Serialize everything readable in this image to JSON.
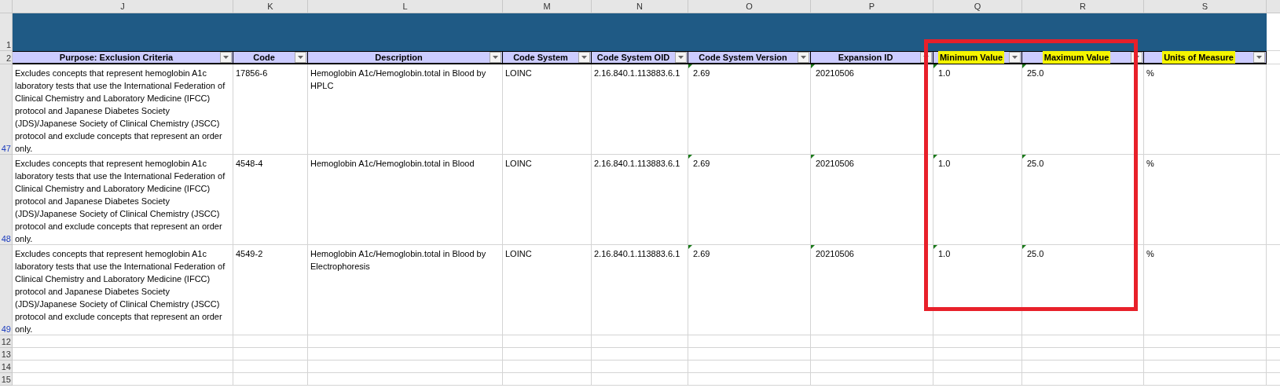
{
  "column_letters": [
    "J",
    "K",
    "L",
    "M",
    "N",
    "O",
    "P",
    "Q",
    "R",
    "S"
  ],
  "title_row": {
    "row_number": "1"
  },
  "header_row": {
    "row_number": "2",
    "columns": [
      {
        "label": "Purpose: Exclusion Criteria",
        "highlighted": false
      },
      {
        "label": "Code",
        "highlighted": false
      },
      {
        "label": "Description",
        "highlighted": false
      },
      {
        "label": "Code System",
        "highlighted": false
      },
      {
        "label": "Code System OID",
        "highlighted": false
      },
      {
        "label": "Code System Version",
        "highlighted": false
      },
      {
        "label": "Expansion ID",
        "highlighted": false
      },
      {
        "label": "Minimum Value",
        "highlighted": true
      },
      {
        "label": "Maximum Value",
        "highlighted": true
      },
      {
        "label": "Units of Measure",
        "highlighted": true
      }
    ]
  },
  "rows": [
    {
      "row_number": "47",
      "cells": [
        {
          "text": "Excludes concepts that represent hemoglobin A1c laboratory tests that use the International Federation of Clinical Chemistry and Laboratory Medicine (IFCC) protocol and Japanese Diabetes Society (JDS)/Japanese Society of Clinical Chemistry (JSCC) protocol and exclude concepts that represent an order only.",
          "flagged": false
        },
        {
          "text": "17856-6",
          "flagged": false
        },
        {
          "text": "Hemoglobin A1c/Hemoglobin.total in Blood by HPLC",
          "flagged": false
        },
        {
          "text": "LOINC",
          "flagged": false
        },
        {
          "text": "2.16.840.1.113883.6.1",
          "flagged": false
        },
        {
          "text": "2.69",
          "flagged": true
        },
        {
          "text": "20210506",
          "flagged": true
        },
        {
          "text": "1.0",
          "flagged": true
        },
        {
          "text": "25.0",
          "flagged": true
        },
        {
          "text": "%",
          "flagged": false
        }
      ]
    },
    {
      "row_number": "48",
      "cells": [
        {
          "text": "Excludes concepts that represent hemoglobin A1c laboratory tests that use the International Federation of Clinical Chemistry and Laboratory Medicine (IFCC) protocol and Japanese Diabetes Society (JDS)/Japanese Society of Clinical Chemistry (JSCC) protocol and exclude concepts that represent an order only.",
          "flagged": false
        },
        {
          "text": "4548-4",
          "flagged": false
        },
        {
          "text": "Hemoglobin A1c/Hemoglobin.total in Blood",
          "flagged": false
        },
        {
          "text": "LOINC",
          "flagged": false
        },
        {
          "text": "2.16.840.1.113883.6.1",
          "flagged": false
        },
        {
          "text": "2.69",
          "flagged": true
        },
        {
          "text": "20210506",
          "flagged": true
        },
        {
          "text": "1.0",
          "flagged": true
        },
        {
          "text": "25.0",
          "flagged": true
        },
        {
          "text": "%",
          "flagged": false
        }
      ]
    },
    {
      "row_number": "49",
      "cells": [
        {
          "text": "Excludes concepts that represent hemoglobin A1c laboratory tests that use the International Federation of Clinical Chemistry and Laboratory Medicine (IFCC) protocol and Japanese Diabetes Society (JDS)/Japanese Society of Clinical Chemistry (JSCC) protocol and exclude concepts that represent an order only.",
          "flagged": false
        },
        {
          "text": "4549-2",
          "flagged": false
        },
        {
          "text": "Hemoglobin A1c/Hemoglobin.total in Blood by Electrophoresis",
          "flagged": false
        },
        {
          "text": "LOINC",
          "flagged": false
        },
        {
          "text": "2.16.840.1.113883.6.1",
          "flagged": false
        },
        {
          "text": "2.69",
          "flagged": true
        },
        {
          "text": "20210506",
          "flagged": true
        },
        {
          "text": "1.0",
          "flagged": true
        },
        {
          "text": "25.0",
          "flagged": true
        },
        {
          "text": "%",
          "flagged": false
        }
      ]
    }
  ],
  "empty_rows": [
    "12",
    "13",
    "14",
    "15"
  ],
  "annotations": [
    {
      "kind": "rectangle"
    }
  ]
}
